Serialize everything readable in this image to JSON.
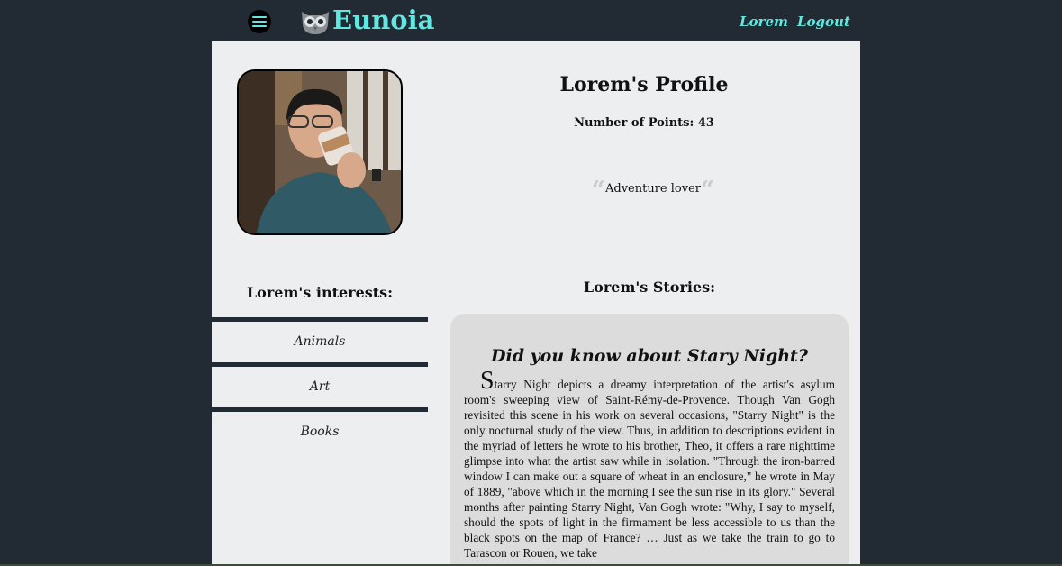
{
  "header": {
    "brand": "Eunoia",
    "nav_user": "Lorem",
    "nav_logout": "Logout",
    "accent_color": "#5fe9e2"
  },
  "profile": {
    "title": "Lorem's Profile",
    "points_label": "Number of Points: 43",
    "bio": "Adventure lover",
    "quote_open": "“",
    "quote_close": "“"
  },
  "interests": {
    "title": "Lorem's interests:",
    "items": [
      {
        "label": "Animals"
      },
      {
        "label": "Art"
      },
      {
        "label": "Books"
      }
    ]
  },
  "stories": {
    "title": "Lorem's Stories:",
    "story": {
      "title": "Did you know about Stary Night?",
      "first_letter": "S",
      "body": "tarry Night depicts a dreamy interpretation of the artist's asylum room's sweeping view of Saint-Rémy-de-Provence. Though Van Gogh revisited this scene in his work on several occasions, \"Starry Night\" is the only nocturnal study of the view. Thus, in addition to descriptions evident in the myriad of letters he wrote to his brother, Theo, it offers a rare nighttime glimpse into what the artist saw while in isolation. \"Through the iron-barred window I can make out a square of wheat in an enclosure,\" he wrote in May of 1889, \"above which in the morning I see the sun rise in its glory.\" Several months after painting Starry Night, Van Gogh wrote: \"Why, I say to myself, should the spots of light in the firmament be less accessible to us than the black spots on the map of France? … Just as we take the train to go to Tarascon or Rouen, we take"
    }
  }
}
